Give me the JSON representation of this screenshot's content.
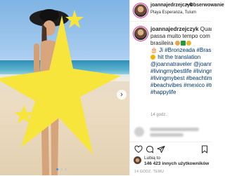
{
  "post": {
    "username": "joannajedrzejczyk",
    "separator": "•",
    "follow_label": "Obserwowanie",
    "location": "Playa Esperanza, Tulum"
  },
  "caption": {
    "author": "joannajedrzejczyk",
    "lines": [
      "Quando",
      "passa muito tempo com sua",
      "brasileira",
      "🎂 Ji #Bronzeada #Brasil #bu",
      "hit the translation",
      "@joannatraveler @joannadrz",
      "#livingmybestlife #livingmylif",
      "#livingmybest #beachtime #b",
      "#beachvibes #mexico #tulum",
      "#happylife"
    ],
    "time": "14 godz."
  },
  "likes": {
    "line1": "Lubią to",
    "line2_count": "146 423",
    "line2_rest": "innych użytkowników"
  },
  "date": "14 GODZ. TEMU",
  "colors": {
    "accent": "#3897f0",
    "star": "#f7e53b",
    "link": "#003569"
  },
  "icons": [
    "heart-icon",
    "comment-icon",
    "share-icon",
    "bookmark-icon",
    "next-arrow-icon"
  ]
}
